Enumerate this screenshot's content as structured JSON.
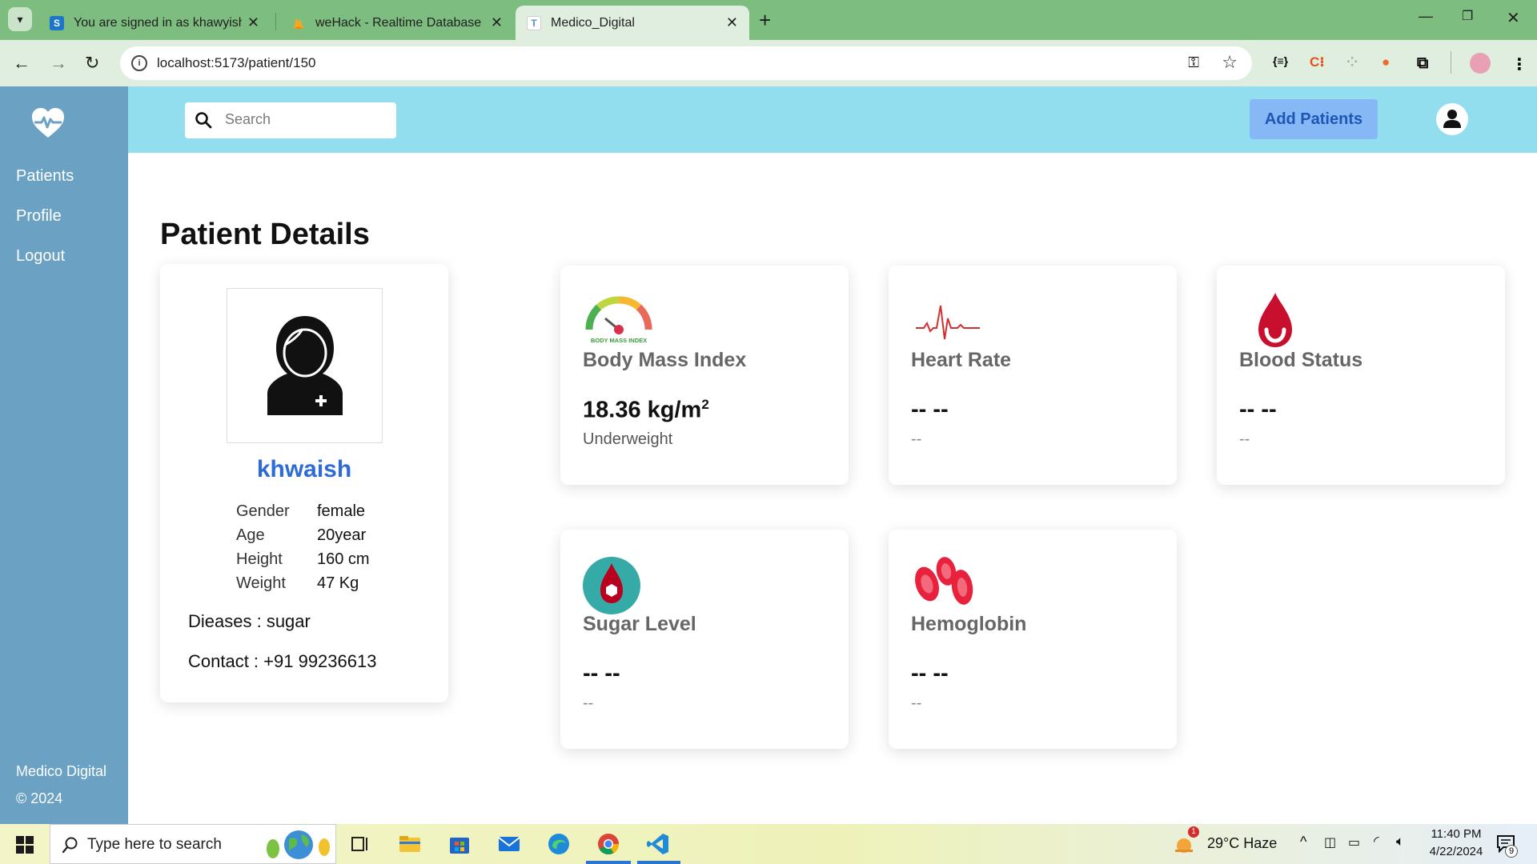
{
  "browser": {
    "tabs": [
      {
        "title": "You are signed in as khawyishs",
        "favicon": "S",
        "active": false
      },
      {
        "title": "weHack - Realtime Database -",
        "favicon": "firebase",
        "active": false
      },
      {
        "title": "Medico_Digital",
        "favicon": "T",
        "active": true
      }
    ],
    "url": "localhost:5173/patient/150"
  },
  "sidebar": {
    "items": [
      {
        "label": "Patients"
      },
      {
        "label": "Profile"
      },
      {
        "label": "Logout"
      }
    ],
    "footer_brand": "Medico Digital",
    "footer_year": "© 2024"
  },
  "header": {
    "search_placeholder": "Search",
    "add_button": "Add Patients"
  },
  "page": {
    "title": "Patient Details"
  },
  "patient": {
    "name": "khwaish",
    "fields": [
      {
        "label": "Gender",
        "value": "female"
      },
      {
        "label": "Age",
        "value": "20year"
      },
      {
        "label": "Height",
        "value": "160 cm"
      },
      {
        "label": "Weight",
        "value": "47 Kg"
      }
    ],
    "disease_line": "Dieases : sugar",
    "contact_line": "Contact : +91 99236613"
  },
  "metrics": [
    {
      "title": "Body Mass Index",
      "value": "18.36 kg/m",
      "value_sup": "2",
      "sub": "Underweight",
      "icon": "bmi-gauge-icon"
    },
    {
      "title": "Heart Rate",
      "value": "-- --",
      "sub": "--",
      "icon": "heartbeat-icon"
    },
    {
      "title": "Blood Status",
      "value": "-- --",
      "sub": "--",
      "icon": "blood-drop-icon"
    },
    {
      "title": "Sugar Level",
      "value": "-- --",
      "sub": "--",
      "icon": "sugar-drop-icon"
    },
    {
      "title": "Hemoglobin",
      "value": "-- --",
      "sub": "--",
      "icon": "red-blood-cells-icon"
    }
  ],
  "bmi_gauge_label": "BODY MASS INDEX",
  "taskbar": {
    "search_placeholder": "Type here to search",
    "weather": "29°C  Haze",
    "weather_badge": "1",
    "time": "11:40 PM",
    "date": "4/22/2024",
    "notification_count": "9"
  },
  "colors": {
    "sidebar": "#6ba2c4",
    "header": "#93deee",
    "add_button": "#86b8f5",
    "patient_name": "#2f6bd6",
    "tab_strip": "#7ebd80"
  }
}
